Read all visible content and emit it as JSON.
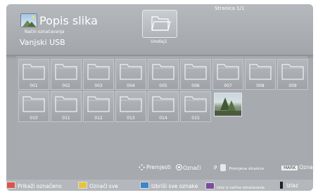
{
  "header": {
    "title": "Popis slika",
    "subtitle": "Način označavanja",
    "source": "Vanjski USB",
    "page_info": "Stranica 1/1",
    "device_label": "Uređaj1",
    "app_icon": "photo-album-icon",
    "device_icon": "folder-open-icon"
  },
  "grid": {
    "items": [
      {
        "label": "001",
        "type": "folder"
      },
      {
        "label": "002",
        "type": "folder"
      },
      {
        "label": "003",
        "type": "folder"
      },
      {
        "label": "004",
        "type": "folder"
      },
      {
        "label": "005",
        "type": "folder"
      },
      {
        "label": "006",
        "type": "folder"
      },
      {
        "label": "007",
        "type": "folder"
      },
      {
        "label": "008",
        "type": "folder"
      },
      {
        "label": "009",
        "type": "folder"
      },
      {
        "label": "010",
        "type": "folder"
      },
      {
        "label": "011",
        "type": "folder"
      },
      {
        "label": "012",
        "type": "folder"
      },
      {
        "label": "013",
        "type": "folder"
      },
      {
        "label": "014",
        "type": "folder"
      },
      {
        "label": "015",
        "type": "folder"
      },
      {
        "label": "",
        "type": "photo"
      }
    ]
  },
  "hints": {
    "move": "Premjesti",
    "select": "Označi",
    "page_key": "P",
    "page_change": "Promjena stranice",
    "mark_key": "MARK",
    "mark": "Označi"
  },
  "footer": {
    "buttons": [
      {
        "label": "Prikaži označeno",
        "color": "#d9534f"
      },
      {
        "label": "Označi sve",
        "color": "#e5c53a"
      },
      {
        "label": "Izbriši sve oznake",
        "color": "#3a86c8"
      },
      {
        "label": "Izlaz iz načina označavanja",
        "color": "#7a4c9e"
      },
      {
        "label": "Izlaz",
        "color": "#222222"
      }
    ]
  },
  "colors": {
    "background": "#a6aaaf",
    "header": "#b0b4b8",
    "text": "#ffffff"
  }
}
